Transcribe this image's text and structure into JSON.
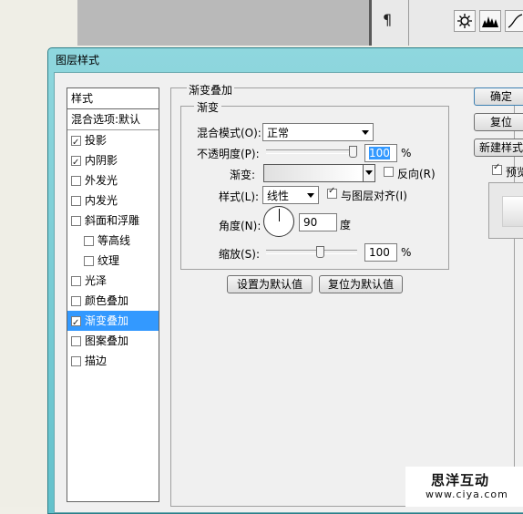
{
  "dialog": {
    "title": "图层样式"
  },
  "style_list": {
    "header": "样式",
    "blend_options": "混合选项:默认",
    "items": [
      {
        "label": "投影",
        "checked": true,
        "sub": false,
        "selected": false
      },
      {
        "label": "内阴影",
        "checked": true,
        "sub": false,
        "selected": false
      },
      {
        "label": "外发光",
        "checked": false,
        "sub": false,
        "selected": false
      },
      {
        "label": "内发光",
        "checked": false,
        "sub": false,
        "selected": false
      },
      {
        "label": "斜面和浮雕",
        "checked": false,
        "sub": false,
        "selected": false
      },
      {
        "label": "等高线",
        "checked": false,
        "sub": true,
        "selected": false
      },
      {
        "label": "纹理",
        "checked": false,
        "sub": true,
        "selected": false
      },
      {
        "label": "光泽",
        "checked": false,
        "sub": false,
        "selected": false
      },
      {
        "label": "颜色叠加",
        "checked": false,
        "sub": false,
        "selected": false
      },
      {
        "label": "渐变叠加",
        "checked": true,
        "sub": false,
        "selected": true
      },
      {
        "label": "图案叠加",
        "checked": false,
        "sub": false,
        "selected": false
      },
      {
        "label": "描边",
        "checked": false,
        "sub": false,
        "selected": false
      }
    ]
  },
  "gradient_overlay": {
    "group_title": "渐变叠加",
    "inner_title": "渐变",
    "blend_mode_label": "混合模式(O):",
    "blend_mode_value": "正常",
    "opacity_label": "不透明度(P):",
    "opacity_value": "100",
    "opacity_level": 1.0,
    "opacity_unit": "%",
    "gradient_label": "渐变:",
    "reverse_label": "反向(R)",
    "reverse_checked": false,
    "style_label": "样式(L):",
    "style_value": "线性",
    "align_label": "与图层对齐(I)",
    "align_checked": true,
    "angle_label": "角度(N):",
    "angle_value": "90",
    "angle_unit": "度",
    "scale_label": "缩放(S):",
    "scale_value": "100",
    "scale_level": 0.6,
    "scale_unit": "%",
    "set_default_button": "设置为默认值",
    "reset_default_button": "复位为默认值"
  },
  "side_buttons": {
    "ok": "确定",
    "reset": "复位",
    "new_style": "新建样式",
    "preview_label": "预览",
    "preview_checked": true
  },
  "panel": {
    "paragraph_glyph": "¶"
  },
  "logo": {
    "line1": "思洋互动",
    "line2": "www.ciya.com"
  },
  "colors": {
    "selection": "#3399ff",
    "dialog_frame": "#63c1cc"
  }
}
